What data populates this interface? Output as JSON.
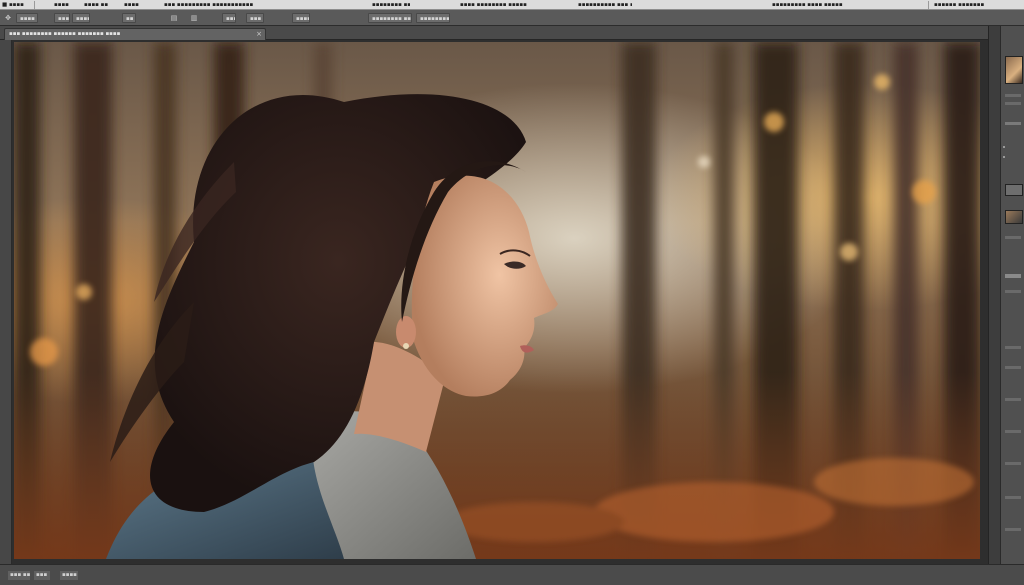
{
  "menu_bar": {
    "items": [
      "■ ▪▪▪▪",
      "▪▪▪▪",
      "▪▪▪▪ ▪▪",
      "▪▪▪▪",
      "▪▪▪ ▪▪▪▪▪▪▪▪▪ ▪▪▪▪▪▪▪▪▪▪▪",
      "▪▪▪▪▪▪▪▪ ▪▪▪▪▪▪",
      "▪▪▪▪ ▪▪▪▪▪▪▪▪ ▪▪▪▪▪",
      "▪▪▪▪▪▪▪▪▪▪ ▪▪▪ ▪▪▪▪",
      "▪▪▪▪▪▪▪▪▪ ▪▪▪▪ ▪▪▪▪▪",
      "▪▪▪▪▪▪ ▪▪▪▪▪▪▪"
    ]
  },
  "options_bar": {
    "items": [
      "▪▪▪▪",
      "▪▪▪",
      "▪▪▪▪",
      "▪▪",
      "▪▪▪▪▪",
      "▪▪▪",
      "▪▪▪▪",
      "▪▪▪▪▪▪▪▪ ▪▪▪▪▪▪",
      "▪▪▪▪▪▪▪▪▪"
    ]
  },
  "document_tab": {
    "label": "▪▪▪ ▪▪▪▪▪▪▪▪ ▪▪▪▪▪▪ ▪▪▪▪▪▪▪ ▪▪▪▪",
    "close": "×"
  },
  "status_bar": {
    "items": [
      "▪▪▪ ▪▪",
      "▪▪▪",
      "▪▪▪▪"
    ]
  },
  "canvas": {
    "content": "photo-woman-profile-forest"
  },
  "colors": {
    "menubar_bg": "#dcdcdc",
    "toolbar_bg": "#5a5a5a",
    "panel_bg": "#4a4a4a",
    "canvas_accent": "#e8a45a"
  },
  "icons": {
    "move_tool": "move-icon",
    "close": "close-icon",
    "layer_thumb": "layer-thumbnail-icon"
  }
}
